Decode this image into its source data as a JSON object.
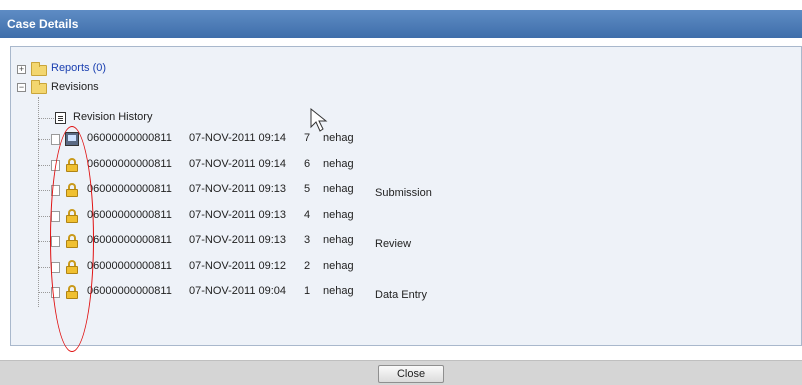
{
  "window": {
    "title": "Case Details"
  },
  "tree": {
    "reports": {
      "expander": "+",
      "label": "Reports (0)",
      "icon": "folder-icon"
    },
    "revisions": {
      "expander": "−",
      "label": "Revisions",
      "icon": "folder-icon"
    },
    "revision_history": {
      "label": "Revision History",
      "icon": "revision-history-icon"
    },
    "rows": [
      {
        "case_number": "06000000000811",
        "date": "07-NOV-2011 09:14",
        "revision": "7",
        "user": "nehag",
        "workflow": "",
        "icon": "computer-icon"
      },
      {
        "case_number": "06000000000811",
        "date": "07-NOV-2011 09:14",
        "revision": "6",
        "user": "nehag",
        "workflow": "",
        "icon": "lock-icon"
      },
      {
        "case_number": "06000000000811",
        "date": "07-NOV-2011 09:13",
        "revision": "5",
        "user": "nehag",
        "workflow": "Submission",
        "icon": "lock-icon"
      },
      {
        "case_number": "06000000000811",
        "date": "07-NOV-2011 09:13",
        "revision": "4",
        "user": "nehag",
        "workflow": "",
        "icon": "lock-icon"
      },
      {
        "case_number": "06000000000811",
        "date": "07-NOV-2011 09:13",
        "revision": "3",
        "user": "nehag",
        "workflow": "Review",
        "icon": "lock-icon"
      },
      {
        "case_number": "06000000000811",
        "date": "07-NOV-2011 09:12",
        "revision": "2",
        "user": "nehag",
        "workflow": "",
        "icon": "lock-icon"
      },
      {
        "case_number": "06000000000811",
        "date": "07-NOV-2011 09:04",
        "revision": "1",
        "user": "nehag",
        "workflow": "Data Entry",
        "icon": "lock-icon"
      }
    ]
  },
  "footer": {
    "close_label": "Close"
  },
  "colors": {
    "titlebar": "#4a7ab6",
    "link": "#1a3fb0",
    "annotation": "#e01010",
    "panel": "#eef2f8"
  }
}
